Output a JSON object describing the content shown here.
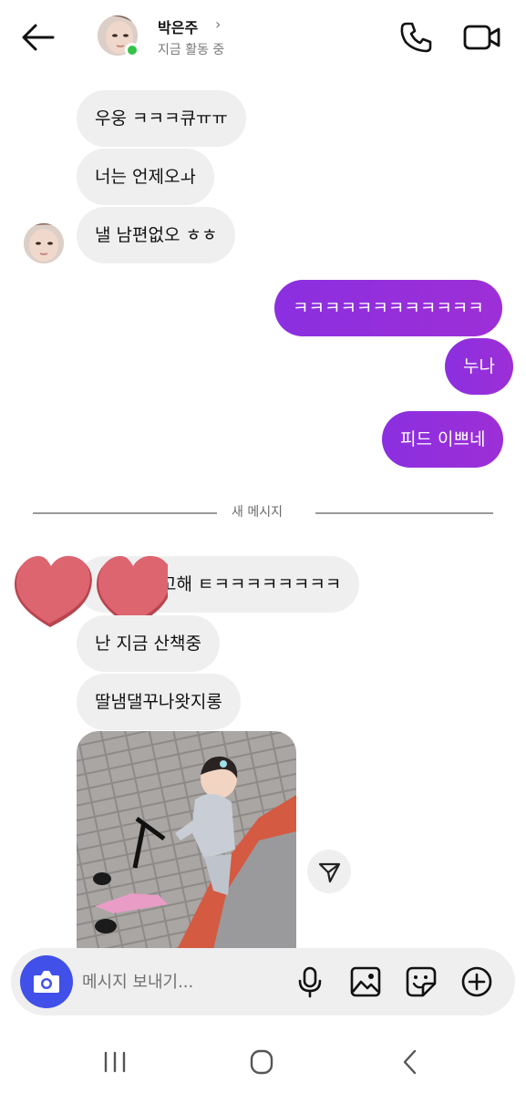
{
  "header": {
    "contact_name": "박은주",
    "chevron": "›",
    "status": "지금 활동 중",
    "icons": {
      "back": "arrow-left-icon",
      "call": "phone-icon",
      "video": "video-camera-icon"
    }
  },
  "messages": [
    {
      "dir": "in",
      "text": "우웅 ㅋㅋㅋ큐ㅠㅠ"
    },
    {
      "dir": "in",
      "text": "너는 언제오ㅘ"
    },
    {
      "dir": "in",
      "text": "낼 남편없오 ㅎㅎ"
    },
    {
      "dir": "out",
      "text": "ㅋㅋㅋㅋㅋㅋㅋㅋㅋㅋㅋㅋ"
    },
    {
      "dir": "out",
      "text": "누나"
    },
    {
      "dir": "out",
      "text": "피드 이쁘네"
    }
  ],
  "divider": "새 메시지",
  "new_messages": [
    {
      "dir": "in",
      "text": "고해 ㅌㅋㅋㅋㅋㅋㅋㅋㅋ"
    },
    {
      "dir": "in",
      "text": "난 지금 산책중"
    },
    {
      "dir": "in",
      "text": "딸냄댈꾸나왓지롱"
    }
  ],
  "photo": {
    "kind": "image",
    "subject": "child on pink scooter on paved path",
    "share_icon": "send-icon"
  },
  "reaction_overlay": {
    "icon": "heart-icon",
    "count_hearts": 2,
    "color": "#d9606b"
  },
  "composer": {
    "placeholder": "메시지 보내기...",
    "value": "",
    "icons": {
      "camera": "camera-icon",
      "mic": "microphone-icon",
      "gallery": "image-icon",
      "sticker": "sticker-icon",
      "more": "plus-circle-icon"
    }
  },
  "navigation": {
    "icons": {
      "recents": "recent-apps-icon",
      "home": "home-icon",
      "back": "back-chevron-icon"
    }
  },
  "colors": {
    "outgoing_bubble": "#9330dd",
    "incoming_bubble": "#efefef",
    "camera_button": "#4050e8",
    "online": "#35c24a"
  }
}
